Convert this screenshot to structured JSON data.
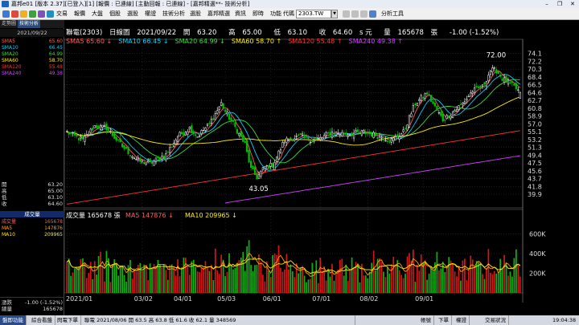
{
  "window": {
    "title": "嘉邦e01 [版本 2.37][已登入][1] [報價 : 已連線] [主動回報 : 已連線] - [嘉邦精選**- 技術分析]",
    "controls": [
      "–",
      "❐",
      "✕"
    ]
  },
  "menu": {
    "items": [
      "交易",
      "報價",
      "大盤",
      "個股",
      "選股",
      "權證",
      "技術分析",
      "選股",
      "嘉邦精選",
      "資訊",
      "即時",
      "功能"
    ],
    "symbol_label": "代碼",
    "symbol_value": "2303.TW",
    "analysis_label": "分析工具"
  },
  "left_panel": {
    "tabs": [
      "走勢圖",
      "技術分析"
    ],
    "date": "2021/09/22",
    "ma_list": [
      {
        "label": "SMA5",
        "value": "65.60",
        "color": "#ff5a5a"
      },
      {
        "label": "SMA10",
        "value": "66.45",
        "color": "#00d0ff"
      },
      {
        "label": "SMA20",
        "value": "64.99",
        "color": "#3cdc3c"
      },
      {
        "label": "SMA60",
        "value": "58.70",
        "color": "#ffee00"
      },
      {
        "label": "SMA120",
        "value": "55.48",
        "color": "#ff3030"
      },
      {
        "label": "SMA240",
        "value": "49.38",
        "color": "#d040ff"
      }
    ],
    "quote": [
      {
        "label": "開",
        "value": "63.20"
      },
      {
        "label": "高",
        "value": "65.00"
      },
      {
        "label": "低",
        "value": "63.10"
      },
      {
        "label": "收",
        "value": "64.60"
      }
    ],
    "volume_header": "成交量",
    "volume_list": [
      {
        "label": "成交量",
        "value": "165678",
        "color": "#ff5a5a"
      },
      {
        "label": "MA5",
        "value": "147876",
        "color": "#ffa000"
      },
      {
        "label": "MA10",
        "value": "209965",
        "color": "#ffee00"
      }
    ],
    "footer": [
      {
        "label": "漲跌",
        "value": "-1.00 (-1.52%)"
      },
      {
        "label": "總量",
        "value": "165678"
      }
    ]
  },
  "chart_header": {
    "name": "聯電(2303)",
    "period": "日線圖",
    "date": "2021/09/22",
    "open_label": "開",
    "open": "63.20",
    "high_label": "高",
    "high": "65.00",
    "low_label": "低",
    "low": "63.10",
    "close_label": "收",
    "close": "64.60",
    "unit": "s 元",
    "vol_label": "量",
    "vol": "165678",
    "vol_unit": "張",
    "change": "-1.00 (-1.52%)"
  },
  "ma_legend": [
    {
      "text": "SMA5 65.60",
      "arrow": "↓",
      "color": "#ff5a5a"
    },
    {
      "text": "SMA10 66.45",
      "arrow": "↓",
      "color": "#00d0ff"
    },
    {
      "text": "SMA20 64.99",
      "arrow": "↓",
      "color": "#3cdc3c"
    },
    {
      "text": "SMA60 58.70",
      "arrow": "↑",
      "color": "#ffee00"
    },
    {
      "text": "SMA120 55.48",
      "arrow": "↑",
      "color": "#ff3030"
    },
    {
      "text": "SMA240 49.38",
      "arrow": "↑",
      "color": "#d040ff"
    }
  ],
  "volume_legend": [
    {
      "text": "成交量 165678",
      "arrow": "張",
      "color": "#ffffff"
    },
    {
      "text": "MA5 147876",
      "arrow": "↓",
      "color": "#ff5a5a"
    },
    {
      "text": "MA10 209965",
      "arrow": "↓",
      "color": "#ffee00"
    }
  ],
  "chart_data": {
    "type": "candlestick",
    "title": "聯電(2303) 日線圖",
    "price_ylim": [
      37.0,
      76.0
    ],
    "price_ticks": [
      "74.1",
      "72.2",
      "70.3",
      "68.4",
      "66.5",
      "64.6",
      "62.7",
      "60.8",
      "58.9",
      "57.0",
      "55.1",
      "53.2",
      "51.3",
      "49.4",
      "47.5",
      "45.6",
      "43.7",
      "41.8",
      "39.9"
    ],
    "volume_ylim": [
      0,
      750000
    ],
    "volume_ticks": [
      {
        "label": "600K",
        "v": 600000
      },
      {
        "label": "400K",
        "v": 400000
      },
      {
        "label": "200K",
        "v": 200000
      }
    ],
    "x_tick_labels": [
      "2021/01",
      "03/02",
      "04/01",
      "05/03",
      "06/01",
      "07/01",
      "08/02",
      "09/01"
    ],
    "annotations": [
      {
        "text": "72.00",
        "kind": "high"
      },
      {
        "text": "43.05",
        "kind": "low"
      }
    ],
    "close_anchor": [
      [
        0,
        55.0
      ],
      [
        8,
        53.0
      ],
      [
        14,
        56.5
      ],
      [
        20,
        56.0
      ],
      [
        28,
        51.5
      ],
      [
        36,
        48.0
      ],
      [
        42,
        47.5
      ],
      [
        50,
        49.5
      ],
      [
        56,
        54.0
      ],
      [
        62,
        56.0
      ],
      [
        66,
        54.0
      ],
      [
        72,
        57.0
      ],
      [
        78,
        62.0
      ],
      [
        80,
        60.0
      ],
      [
        84,
        57.0
      ],
      [
        90,
        52.0
      ],
      [
        93,
        46.0
      ],
      [
        96,
        44.0
      ],
      [
        100,
        46.5
      ],
      [
        104,
        47.0
      ],
      [
        110,
        53.0
      ],
      [
        118,
        54.0
      ],
      [
        126,
        53.0
      ],
      [
        134,
        55.0
      ],
      [
        142,
        54.5
      ],
      [
        150,
        55.0
      ],
      [
        158,
        54.0
      ],
      [
        164,
        53.0
      ],
      [
        170,
        55.0
      ],
      [
        176,
        62.0
      ],
      [
        182,
        64.5
      ],
      [
        186,
        61.0
      ],
      [
        190,
        58.0
      ],
      [
        194,
        59.5
      ],
      [
        200,
        62.0
      ],
      [
        205,
        65.0
      ],
      [
        210,
        66.0
      ],
      [
        214,
        70.0
      ],
      [
        217,
        70.0
      ],
      [
        220,
        68.0
      ],
      [
        223,
        67.0
      ],
      [
        226,
        66.0
      ],
      [
        229,
        64.6
      ]
    ],
    "candle_count": 230,
    "last_bar": {
      "open": 63.2,
      "high": 65.0,
      "low": 63.1,
      "close": 64.6,
      "volume": 165678
    },
    "sma": [
      {
        "name": "SMA5",
        "last": 65.6
      },
      {
        "name": "SMA10",
        "last": 66.45
      },
      {
        "name": "SMA20",
        "last": 64.99
      },
      {
        "name": "SMA60",
        "last": 58.7
      },
      {
        "name": "SMA120",
        "last": 55.48
      },
      {
        "name": "SMA240",
        "last": 49.38
      }
    ],
    "volume_ma": [
      {
        "name": "MA5",
        "last": 147876
      },
      {
        "name": "MA10",
        "last": 209965
      }
    ],
    "colors": {
      "up": "#ff2a2a",
      "down": "#00c000",
      "grid": "#3a3a3a",
      "axis_text": "#dddddd"
    }
  },
  "status": {
    "items": [
      "盤即功能",
      "綜合看盤",
      "閃電下單",
      "聯電 2021/08/06 開 63.5 高 63.8 低 61.6 收 62.1 量 348569",
      "帳號",
      "下單",
      "權證",
      "交易狀況",
      "19:04:38"
    ]
  }
}
